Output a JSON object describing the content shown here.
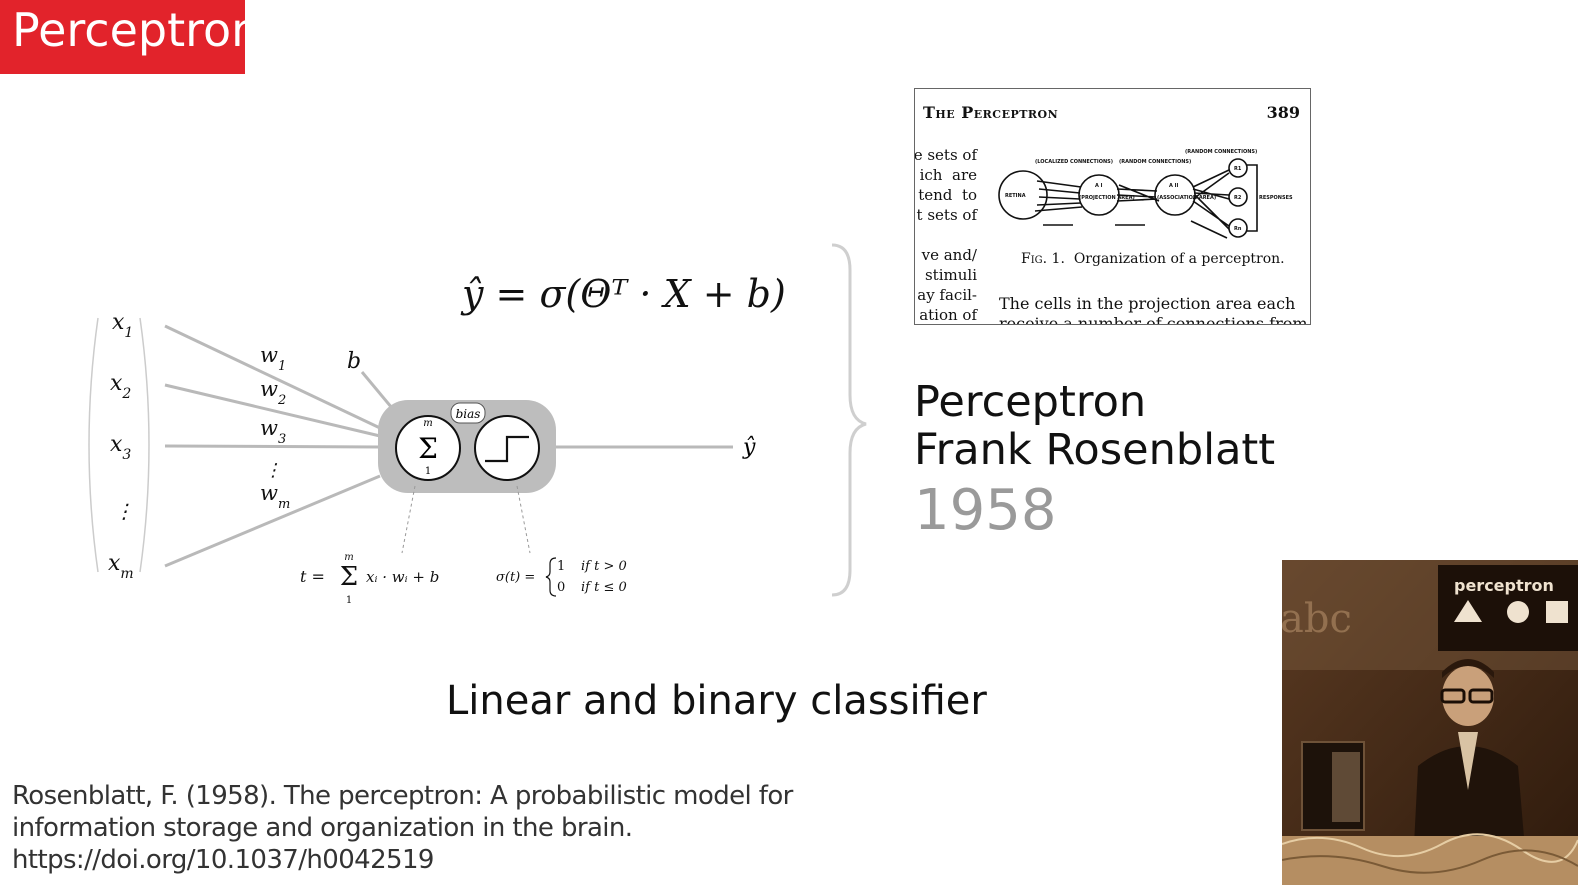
{
  "slide": {
    "title": "Perceptron",
    "tagline": "Linear and binary classifier",
    "accent_color": "#e2232b"
  },
  "diagram": {
    "formula": "ŷ = σ(Θᵀ · X + b)",
    "inputs": [
      {
        "base": "x",
        "sub": "1"
      },
      {
        "base": "x",
        "sub": "2"
      },
      {
        "base": "x",
        "sub": "3"
      },
      {
        "base": "x",
        "sub": "m"
      }
    ],
    "weights": [
      {
        "base": "w",
        "sub": "1"
      },
      {
        "base": "w",
        "sub": "2"
      },
      {
        "base": "w",
        "sub": "3"
      },
      {
        "base": "w",
        "sub": "m"
      }
    ],
    "bias_symbol": "b",
    "bias_tag": "bias",
    "sum_symbol": "Σ",
    "sum_upper": "m",
    "sum_lower": "1",
    "output": "ŷ",
    "vertical_ellipsis": "⋮",
    "sum_formula": {
      "lhs": "t =",
      "upper": "m",
      "sigma": "Σ",
      "lower": "1",
      "rhs": "xᵢ · wᵢ + b"
    },
    "activation_formula": {
      "lhs": "σ(t) =",
      "case1_value": "1",
      "case1_cond": "if t > 0",
      "case2_value": "0",
      "case2_cond": "if t ≤ 0"
    }
  },
  "paper": {
    "header": "The Perceptron",
    "page": "389",
    "column_text": "e sets of\nich  are\ntend  to\nt sets of\n\nve and/\n stimuli\nay facil-\nation of",
    "figure_labels": {
      "retina": "RETINA",
      "projection": "(PROJECTION AREA)",
      "association": "(ASSOCIATION AREA)",
      "a1": "A I",
      "a2": "A II",
      "localized": "(LOCALIZED CONNECTIONS)",
      "random1": "(RANDOM CONNECTIONS)",
      "random2": "(RANDOM CONNECTIONS)",
      "responses": "RESPONSES",
      "r1": "R1",
      "r2": "R2",
      "rn": "Rn"
    },
    "caption_fig": "Fig. 1.",
    "caption_text": "Organization of a perceptron.",
    "body_line1": "The cells in the projection area each",
    "body_line2": "receive a number of connections from"
  },
  "side": {
    "line1": "Perceptron",
    "line2": "Frank Rosenblatt",
    "year": "1958"
  },
  "reference": {
    "line1": "Rosenblatt, F. (1958). The perceptron: A probabilistic model for",
    "line2": "information storage and organization in the brain.",
    "line3": "https://doi.org/10.1037/h0042519"
  },
  "photo": {
    "sign_text": "perceptron",
    "bg_letters": "abc"
  }
}
